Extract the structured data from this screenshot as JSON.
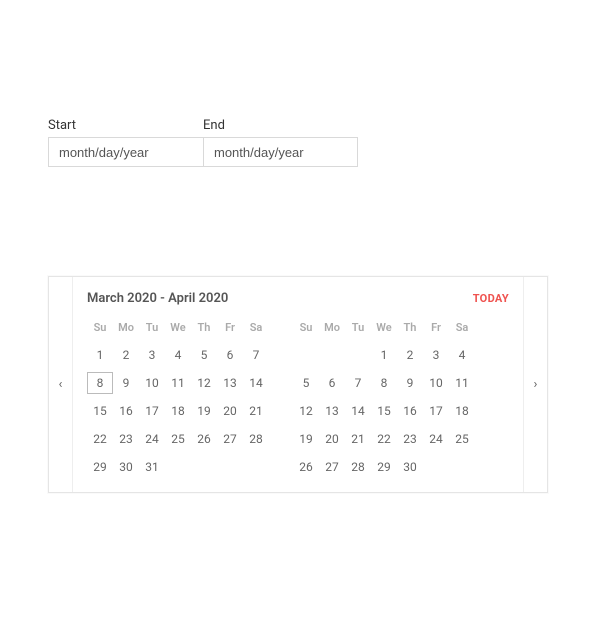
{
  "fields": {
    "start_label": "Start",
    "end_label": "End",
    "start_placeholder": "month/day/year",
    "end_placeholder": "month/day/year",
    "start_value": "",
    "end_value": ""
  },
  "calendar": {
    "range_title": "March 2020 - April 2020",
    "today_label": "TODAY",
    "nav_prev_glyph": "‹",
    "nav_next_glyph": "›",
    "day_abbrevs": [
      "Su",
      "Mo",
      "Tu",
      "We",
      "Th",
      "Fr",
      "Sa"
    ],
    "months": [
      {
        "name": "March 2020",
        "lead_blanks": 0,
        "today_day": 8,
        "days": [
          1,
          2,
          3,
          4,
          5,
          6,
          7,
          8,
          9,
          10,
          11,
          12,
          13,
          14,
          15,
          16,
          17,
          18,
          19,
          20,
          21,
          22,
          23,
          24,
          25,
          26,
          27,
          28,
          29,
          30,
          31
        ]
      },
      {
        "name": "April 2020",
        "lead_blanks": 3,
        "today_day": null,
        "days": [
          1,
          2,
          3,
          4,
          5,
          6,
          7,
          8,
          9,
          10,
          11,
          12,
          13,
          14,
          15,
          16,
          17,
          18,
          19,
          20,
          21,
          22,
          23,
          24,
          25,
          26,
          27,
          28,
          29,
          30
        ]
      }
    ]
  }
}
